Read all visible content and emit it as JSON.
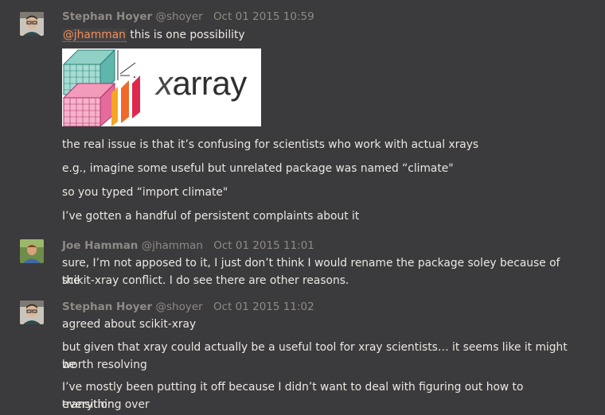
{
  "messages": [
    {
      "author": "Stephan Hoyer",
      "handle": "@shoyer",
      "timestamp": "Oct 01 2015 10:59",
      "mention": "@jhamman",
      "lines": [
        "this is one possibility",
        "the real issue is that it’s confusing for scientists who work with actual xrays",
        "e.g., imagine some useful but unrelated package was named “climate\"",
        "so you typed “import climate\"",
        "I’ve gotten a handful of persistent complaints about it"
      ],
      "image": {
        "logo_text": "xarray",
        "logo_letter": "x",
        "logo_rest": "array"
      }
    },
    {
      "author": "Joe Hamman",
      "handle": "@jhamman",
      "timestamp": "Oct 01 2015 11:01",
      "lines": [
        "sure, I’m not apposed to it, I just don’t think I would rename the package soley because of the",
        "scikit-xray conflict. I do see there are other reasons."
      ]
    },
    {
      "author": "Stephan Hoyer",
      "handle": "@shoyer",
      "timestamp": "Oct 01 2015 11:02",
      "lines": [
        "agreed about scikit-xray",
        "but given that xray could actually be a useful tool for xray scientists… it seems like it might be",
        "worth resolving",
        "I’ve mostly been putting it off because I didn’t want to deal with figuring out how to transition",
        "everything over"
      ]
    }
  ],
  "colors": {
    "background": "#3b3a3c",
    "meta": "#8e8b86",
    "mention": "#f28f5c"
  }
}
